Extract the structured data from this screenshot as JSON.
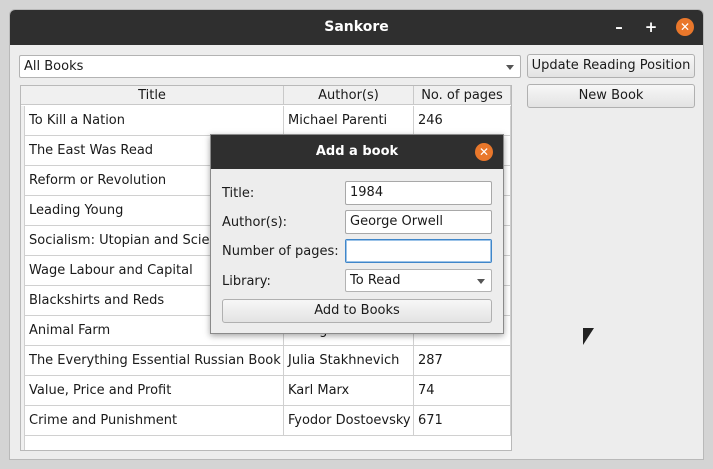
{
  "window": {
    "title": "Sankore",
    "minimize_glyph": "–",
    "maximize_glyph": "+",
    "close_glyph": "✕"
  },
  "toolbar": {
    "library_select": "All Books",
    "update_button": "Update Reading Position",
    "new_book_button": "New Book"
  },
  "table": {
    "columns": [
      "Title",
      "Author(s)",
      "No. of pages"
    ],
    "rows": [
      {
        "title": "To Kill a Nation",
        "author": "Michael Parenti",
        "pages": "246"
      },
      {
        "title": "The East Was Read",
        "author": "",
        "pages": ""
      },
      {
        "title": "Reform or Revolution",
        "author": "",
        "pages": ""
      },
      {
        "title": "Leading Young",
        "author": "",
        "pages": ""
      },
      {
        "title": "Socialism: Utopian and Scientific",
        "author": "",
        "pages": ""
      },
      {
        "title": "Wage Labour and Capital",
        "author": "",
        "pages": ""
      },
      {
        "title": "Blackshirts and Reds",
        "author": "",
        "pages": ""
      },
      {
        "title": "Animal Farm",
        "author": "George Orwell",
        "pages": ""
      },
      {
        "title": "The Everything Essential Russian Book",
        "author": "Julia Stakhnevich",
        "pages": "287"
      },
      {
        "title": "Value, Price and Profit",
        "author": "Karl Marx",
        "pages": "74"
      },
      {
        "title": "Crime and Punishment",
        "author": "Fyodor Dostoevsky",
        "pages": "671"
      }
    ]
  },
  "dialog": {
    "title": "Add a book",
    "close_glyph": "✕",
    "title_label": "Title:",
    "title_value": "1984",
    "author_label": "Author(s):",
    "author_value": "George Orwell",
    "pages_label": "Number of pages:",
    "pages_value": "",
    "library_label": "Library:",
    "library_value": "To Read",
    "submit_button": "Add to Books"
  },
  "colors": {
    "titlebar": "#2f2f2f",
    "close_button": "#e9772b",
    "focus_ring": "#3f86c9"
  }
}
